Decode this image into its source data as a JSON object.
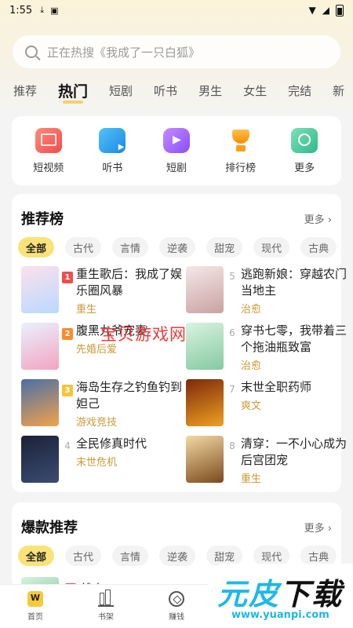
{
  "status_bar": {
    "time": "1:55"
  },
  "search": {
    "placeholder": "正在热搜《我成了一只白狐》"
  },
  "tabs": [
    "推荐",
    "热门",
    "短剧",
    "听书",
    "男生",
    "女生",
    "完结",
    "新"
  ],
  "active_tab": "热门",
  "quick_links": [
    "短视频",
    "听书",
    "短剧",
    "排行榜",
    "更多"
  ],
  "rank_section": {
    "title": "推荐榜",
    "more": "更多",
    "chips": [
      "全部",
      "古代",
      "言情",
      "逆袭",
      "甜宠",
      "现代",
      "古典"
    ],
    "books": [
      {
        "rank": "1",
        "title": "重生歌后：我成了娱乐圈风暴",
        "tag": "重生"
      },
      {
        "rank": "2",
        "title": "腹黑九爷宠妻",
        "tag": "先婚后爱"
      },
      {
        "rank": "3",
        "title": "海岛生存之钓鱼钓到妲己",
        "tag": "游戏竞技"
      },
      {
        "rank": "4",
        "title": "全民修真时代",
        "tag": "末世危机"
      },
      {
        "rank": "5",
        "title": "逃跑新娘：穿越农门当地主",
        "tag": "治愈"
      },
      {
        "rank": "6",
        "title": "穿书七零，我带着三个拖油瓶致富",
        "tag": "治愈"
      },
      {
        "rank": "7",
        "title": "末世全职药师",
        "tag": "爽文"
      },
      {
        "rank": "8",
        "title": "清穿：一不小心成为后宫团宠",
        "tag": "重生"
      }
    ]
  },
  "hot_section": {
    "title": "爆款推荐",
    "more": "更多",
    "chips": [
      "全部",
      "古代",
      "言情",
      "逆袭",
      "甜宠",
      "现代",
      "古典"
    ],
    "first_book": {
      "rank": "1",
      "title": "雏鸟"
    }
  },
  "bottom_nav": [
    "首页",
    "书架",
    "赚钱"
  ],
  "watermark": "宝贝游戏网",
  "logo": {
    "text_1": "元",
    "text_2": "皮",
    "text_3": "下载",
    "url": "www.yuanpi.com"
  },
  "colors": {
    "accent": "#f7c93a",
    "tag": "#c99a3a",
    "rank_top": "#f04d4d"
  }
}
